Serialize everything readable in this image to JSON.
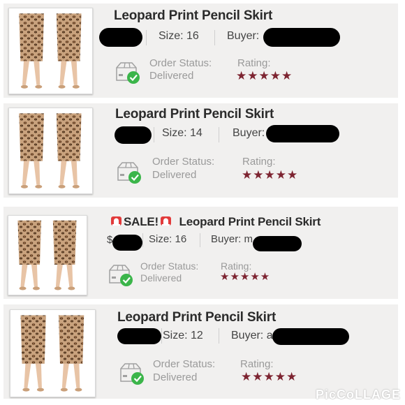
{
  "listings": [
    {
      "title": "Leopard Print Pencil Skirt",
      "size_text": "Size: 16",
      "buyer_label": "Buyer:",
      "status_label": "Order Status:",
      "status_value": "Delivered",
      "rating_label": "Rating:",
      "stars": "★★★★★"
    },
    {
      "title": "Leopard Print Pencil Skirt",
      "size_text": "Size: 14",
      "buyer_label": "Buyer:",
      "status_label": "Order Status:",
      "status_value": "Delivered",
      "rating_label": "Rating:",
      "stars": "★★★★★"
    },
    {
      "sale_text": "SALE!",
      "title": "Leopard Print Pencil Skirt",
      "price_prefix": "$",
      "size_text": "Size: 16",
      "buyer_label": "Buyer: m",
      "status_label": "Order Status:",
      "status_value": "Delivered",
      "rating_label": "Rating:",
      "stars": "★★★★★"
    },
    {
      "title": "Leopard Print Pencil Skirt",
      "size_text": "Size: 12",
      "buyer_label": "Buyer: a",
      "status_label": "Order Status:",
      "status_value": "Delivered",
      "rating_label": "Rating:",
      "stars": "★★★★★"
    }
  ],
  "watermark": "PicCoLLAGE",
  "colors": {
    "star": "#7d2431",
    "check": "#3bb54a",
    "panel": "#f1f0ef"
  }
}
